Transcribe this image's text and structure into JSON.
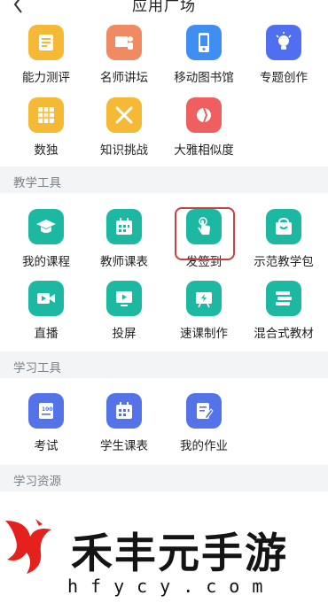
{
  "header": {
    "title": "应用广场"
  },
  "top_apps": [
    {
      "label": "能力测评",
      "icon": "test-document-icon",
      "color": "#f5b935"
    },
    {
      "label": "名师讲坛",
      "icon": "lecture-icon",
      "color": "#ef8a62"
    },
    {
      "label": "移动图书馆",
      "icon": "mobile-library-icon",
      "color": "#3f8ff3"
    },
    {
      "label": "专题创作",
      "icon": "lightbulb-icon",
      "color": "#4f6ef0"
    },
    {
      "label": "数独",
      "icon": "sudoku-grid-icon",
      "color": "#f5b935"
    },
    {
      "label": "知识挑战",
      "icon": "crossed-swords-icon",
      "color": "#f5b935"
    },
    {
      "label": "大雅相似度",
      "icon": "similarity-chart-icon",
      "color": "#ef5f5f"
    }
  ],
  "sections": {
    "teaching": {
      "title": "教学工具"
    },
    "learning": {
      "title": "学习工具"
    },
    "resources": {
      "title": "学习资源"
    }
  },
  "teaching_apps": [
    {
      "label": "我的课程",
      "icon": "graduation-cap-icon",
      "color": "#1db8a2"
    },
    {
      "label": "教师课表",
      "icon": "calendar-icon",
      "color": "#1db8a2"
    },
    {
      "label": "发签到",
      "icon": "tap-hand-icon",
      "color": "#1db8a2"
    },
    {
      "label": "示范教学包",
      "icon": "package-icon",
      "color": "#1db8a2"
    },
    {
      "label": "直播",
      "icon": "video-camera-icon",
      "color": "#1db8a2"
    },
    {
      "label": "投屏",
      "icon": "screen-cast-icon",
      "color": "#1db8a2"
    },
    {
      "label": "速课制作",
      "icon": "quick-lesson-icon",
      "color": "#1db8a2"
    },
    {
      "label": "混合式教材",
      "icon": "books-stack-icon",
      "color": "#1db8a2"
    }
  ],
  "learning_apps": [
    {
      "label": "考试",
      "icon": "exam-score-icon",
      "color": "#5473e8"
    },
    {
      "label": "学生课表",
      "icon": "calendar-icon",
      "color": "#5473e8"
    },
    {
      "label": "我的作业",
      "icon": "homework-edit-icon",
      "color": "#5473e8"
    }
  ],
  "watermark": {
    "text": "禾丰元手游",
    "url": "hfycy.com"
  }
}
